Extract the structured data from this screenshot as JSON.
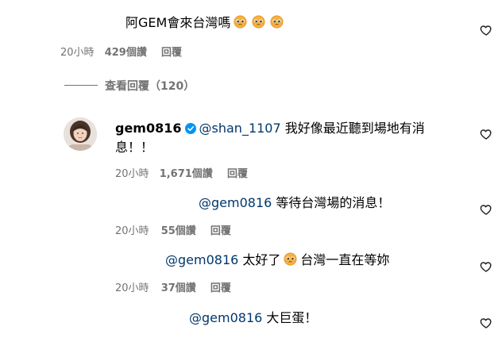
{
  "comment_top": {
    "text": "阿GEM會來台灣嗎",
    "emojis": [
      "pleading-face-icon",
      "pleading-face-icon",
      "pleading-face-icon"
    ],
    "time": "20小時",
    "likes": "429個讚",
    "reply": "回覆"
  },
  "view_replies": "查看回覆（120）",
  "reply_1": {
    "username": "gem0816",
    "mention": "@shan_1107",
    "text_line1": "我好像最近聽到場地有消",
    "text_line2": "息！！",
    "time": "20小時",
    "likes": "1,671個讚",
    "reply": "回覆"
  },
  "reply_2": {
    "mention": "@gem0816",
    "text": "等待台灣場的消息！",
    "time": "20小時",
    "likes": "55個讚",
    "reply": "回覆"
  },
  "reply_3": {
    "mention": "@gem0816",
    "text_before": "太好了",
    "text_after": "台灣一直在等妳",
    "time": "20小時",
    "likes": "37個讚",
    "reply": "回覆"
  },
  "reply_4": {
    "mention": "@gem0816",
    "text": "大巨蛋！"
  },
  "colors": {
    "text": "#000000",
    "secondary": "#737373",
    "mention": "#00376b",
    "verified": "#0095f6"
  }
}
